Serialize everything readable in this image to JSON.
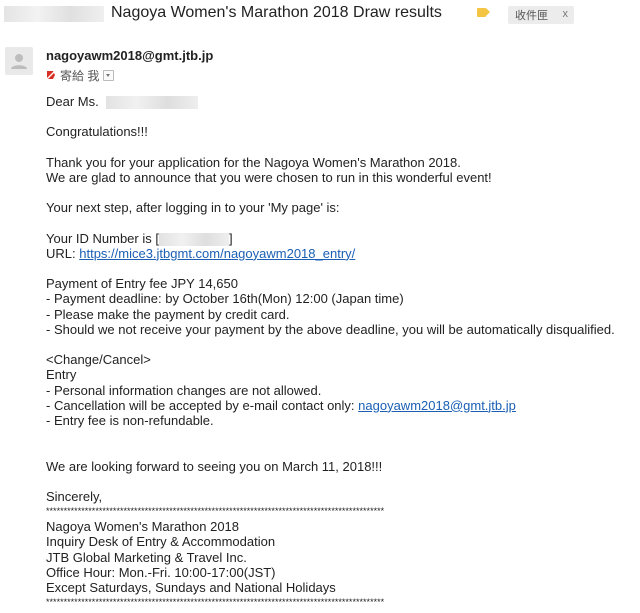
{
  "header": {
    "subject": "Nagoya Women's Marathon 2018 Draw results",
    "inbox_chip": "收件匣",
    "chip_close": "x",
    "label_color": "#f4c542"
  },
  "message": {
    "sender_email": "nagoyawm2018@gmt.jtb.jp",
    "recipient_text": "寄給 我",
    "icons": {
      "avatar": "person-icon",
      "importance": "importance-marker-icon",
      "details": "chevron-down-icon"
    }
  },
  "body": {
    "greeting": "Dear Ms.",
    "congrats": "Congratulations!!!",
    "p1_line1": "Thank you for your application for the Nagoya Women's Marathon 2018.",
    "p1_line2": "We are glad to announce that you were chosen to run in this wonderful event!",
    "next_step": "Your next step, after logging in to your 'My page' is:",
    "id_prefix": "Your ID Number is [",
    "id_suffix": "]",
    "url_prefix": "URL: ",
    "url": "https://mice3.jtbgmt.com/nagoyawm2018_entry/",
    "payment_title": "Payment of Entry fee JPY 14,650",
    "payment_deadline": "- Payment deadline: by October 16th(Mon) 12:00 (Japan time)",
    "payment_card": "- Please make the payment by credit card.",
    "payment_warn": "- Should we not receive your payment by the above deadline, you will be automatically disqualified.",
    "change_cancel": "<Change/Cancel>",
    "entry": "Entry",
    "entry_personal": "- Personal information changes are not allowed.",
    "entry_cancel_prefix": "- Cancellation will be accepted by e-mail contact only: ",
    "entry_cancel_email": "nagoyawm2018@gmt.jtb.jp",
    "entry_fee": "- Entry fee is non-refundable.",
    "closing": "We are looking forward to seeing you on March 11, 2018!!!",
    "sincerely": "Sincerely,",
    "sig_rule": "************************************************************************************************",
    "sig1": "Nagoya Women's Marathon 2018",
    "sig2": "Inquiry Desk of Entry & Accommodation",
    "sig3": "JTB Global Marketing & Travel Inc.",
    "sig4": "Office Hour: Mon.-Fri. 10:00-17:00(JST)",
    "sig5": "Except Saturdays, Sundays and National Holidays"
  }
}
